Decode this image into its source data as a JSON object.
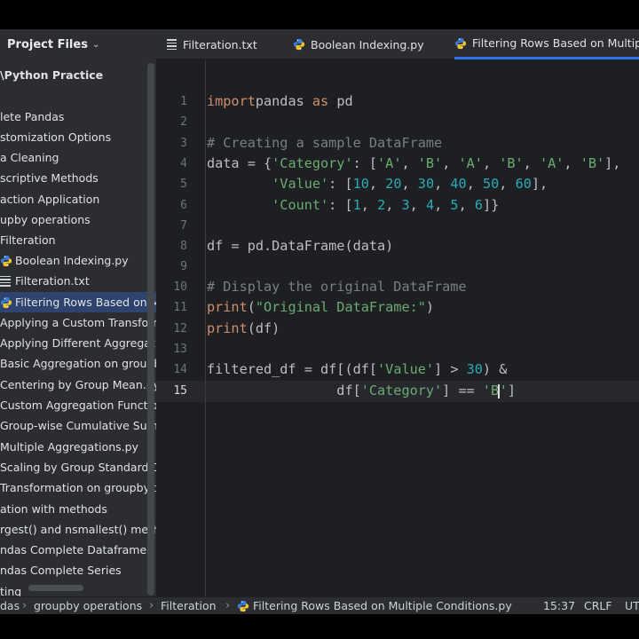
{
  "sidebar": {
    "title": "Project Files",
    "tree": [
      {
        "label": "\\Python Practice",
        "bold": true,
        "icon": ""
      },
      {
        "label": "lete Pandas",
        "icon": ""
      },
      {
        "label": "stomization Options",
        "icon": ""
      },
      {
        "label": "a Cleaning",
        "icon": ""
      },
      {
        "label": "scriptive Methods",
        "icon": ""
      },
      {
        "label": "action Application",
        "icon": ""
      },
      {
        "label": "upby operations",
        "icon": ""
      },
      {
        "label": "Filteration",
        "icon": ""
      },
      {
        "label": "Boolean Indexing.py",
        "icon": "python-file-icon"
      },
      {
        "label": "Filteration.txt",
        "icon": "text-file-icon"
      },
      {
        "label": "Filtering Rows Based on Multiple Conditions.py",
        "icon": "python-file-icon",
        "selected": true
      },
      {
        "label": "Applying a Custom Transformation.py",
        "icon": ""
      },
      {
        "label": "Applying Different Aggregations.py",
        "icon": ""
      },
      {
        "label": "Basic Aggregation on groupby.py",
        "icon": ""
      },
      {
        "label": "Centering by Group Mean.py",
        "icon": ""
      },
      {
        "label": "Custom Aggregation Functions.py",
        "icon": ""
      },
      {
        "label": "Group-wise Cumulative Sum.py",
        "icon": ""
      },
      {
        "label": "Multiple Aggregations.py",
        "icon": ""
      },
      {
        "label": "Scaling by Group Standard Deviation.py",
        "icon": ""
      },
      {
        "label": "Transformation on groupby.txt",
        "icon": ""
      },
      {
        "label": "ation with methods",
        "icon": ""
      },
      {
        "label": "rgest() and nsmallest() methods",
        "icon": ""
      },
      {
        "label": "ndas Complete Dataframe",
        "icon": ""
      },
      {
        "label": "ndas Complete Series",
        "icon": ""
      },
      {
        "label": "ting",
        "icon": ""
      }
    ]
  },
  "tabs": [
    {
      "label": "Filteration.txt",
      "icon": "text-file-icon"
    },
    {
      "label": "Boolean Indexing.py",
      "icon": "python-file-icon"
    },
    {
      "label": "Filtering Rows Based on Multiple Conditions.py",
      "icon": "python-file-icon",
      "active": true
    }
  ],
  "editor": {
    "current_line": 15,
    "lines": [
      {
        "n": "1",
        "tokens": [
          [
            "kw",
            "import"
          ],
          [
            "",
            "pandas "
          ],
          [
            "kw",
            "as"
          ],
          [
            "",
            " pd"
          ]
        ]
      },
      {
        "n": "2",
        "tokens": []
      },
      {
        "n": "3",
        "tokens": [
          [
            "cm",
            "# Creating a sample DataFrame"
          ]
        ]
      },
      {
        "n": "4",
        "tokens": [
          [
            "",
            "data = {"
          ],
          [
            "st",
            "'Category'"
          ],
          [
            "",
            ": ["
          ],
          [
            "st",
            "'A'"
          ],
          [
            "",
            ", "
          ],
          [
            "st",
            "'B'"
          ],
          [
            "",
            ", "
          ],
          [
            "st",
            "'A'"
          ],
          [
            "",
            ", "
          ],
          [
            "st",
            "'B'"
          ],
          [
            "",
            ", "
          ],
          [
            "st",
            "'A'"
          ],
          [
            "",
            ", "
          ],
          [
            "st",
            "'B'"
          ],
          [
            "",
            "],"
          ]
        ]
      },
      {
        "n": "5",
        "tokens": [
          [
            "",
            "        "
          ],
          [
            "st",
            "'Value'"
          ],
          [
            "",
            ": ["
          ],
          [
            "nm",
            "10"
          ],
          [
            "",
            ", "
          ],
          [
            "nm",
            "20"
          ],
          [
            "",
            ", "
          ],
          [
            "nm",
            "30"
          ],
          [
            "",
            ", "
          ],
          [
            "nm",
            "40"
          ],
          [
            "",
            ", "
          ],
          [
            "nm",
            "50"
          ],
          [
            "",
            ", "
          ],
          [
            "nm",
            "60"
          ],
          [
            "",
            "],"
          ]
        ]
      },
      {
        "n": "6",
        "tokens": [
          [
            "",
            "        "
          ],
          [
            "st",
            "'Count'"
          ],
          [
            "",
            ": ["
          ],
          [
            "nm",
            "1"
          ],
          [
            "",
            ", "
          ],
          [
            "nm",
            "2"
          ],
          [
            "",
            ", "
          ],
          [
            "nm",
            "3"
          ],
          [
            "",
            ", "
          ],
          [
            "nm",
            "4"
          ],
          [
            "",
            ", "
          ],
          [
            "nm",
            "5"
          ],
          [
            "",
            ", "
          ],
          [
            "nm",
            "6"
          ],
          [
            "",
            "]}"
          ]
        ]
      },
      {
        "n": "7",
        "tokens": []
      },
      {
        "n": "8",
        "tokens": [
          [
            "",
            "df = pd.DataFrame(data)"
          ]
        ]
      },
      {
        "n": "9",
        "tokens": []
      },
      {
        "n": "10",
        "tokens": [
          [
            "cm",
            "# Display the original DataFrame"
          ]
        ]
      },
      {
        "n": "11",
        "tokens": [
          [
            "kw",
            "print"
          ],
          [
            "",
            "("
          ],
          [
            "st",
            "\"Original DataFrame:\""
          ],
          [
            "",
            ")"
          ]
        ]
      },
      {
        "n": "12",
        "tokens": [
          [
            "kw",
            "print"
          ],
          [
            "",
            "(df)"
          ]
        ]
      },
      {
        "n": "13",
        "tokens": []
      },
      {
        "n": "14",
        "tokens": [
          [
            "",
            "filtered_df = df[(df["
          ],
          [
            "st",
            "'Value'"
          ],
          [
            "",
            "] > "
          ],
          [
            "nm",
            "30"
          ],
          [
            "",
            ") &"
          ]
        ]
      },
      {
        "n": "15",
        "tokens": [
          [
            "",
            "                df["
          ],
          [
            "st",
            "'Category'"
          ],
          [
            "",
            "] == "
          ],
          [
            "st",
            "'B"
          ],
          [
            "caret",
            ""
          ],
          [
            "st",
            "'"
          ],
          [
            "",
            "]"
          ]
        ]
      }
    ]
  },
  "status": {
    "breadcrumbs": [
      "das",
      "groupby operations",
      "Filteration",
      "Filtering Rows Based on Multiple Conditions.py"
    ],
    "position": "15:37",
    "line_ending": "CRLF",
    "encoding": "UT"
  },
  "colors": {
    "background": "#1e1f22",
    "panel": "#2b2d30",
    "accent": "#3574f0",
    "selection": "#2e436e",
    "keyword": "#cf8e6d",
    "string": "#6aab73",
    "number": "#2aacb8",
    "comment": "#7a7e85"
  }
}
